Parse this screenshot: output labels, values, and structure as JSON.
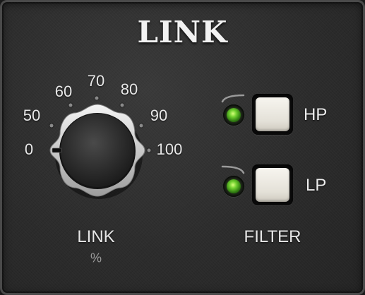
{
  "panel": {
    "title": "LINK"
  },
  "link_knob": {
    "scale_labels": [
      "0",
      "50",
      "60",
      "70",
      "80",
      "90",
      "100"
    ],
    "label": "LINK",
    "unit": "%",
    "value_fraction": 0.0
  },
  "filter": {
    "label": "FILTER",
    "hp": {
      "label": "HP",
      "led_on": true
    },
    "lp": {
      "label": "LP",
      "led_on": true
    }
  },
  "colors": {
    "panel": "#2c2c2c",
    "led_green": "#6fcf2e",
    "button": "#ece9e1",
    "text": "#e8e8e8"
  }
}
